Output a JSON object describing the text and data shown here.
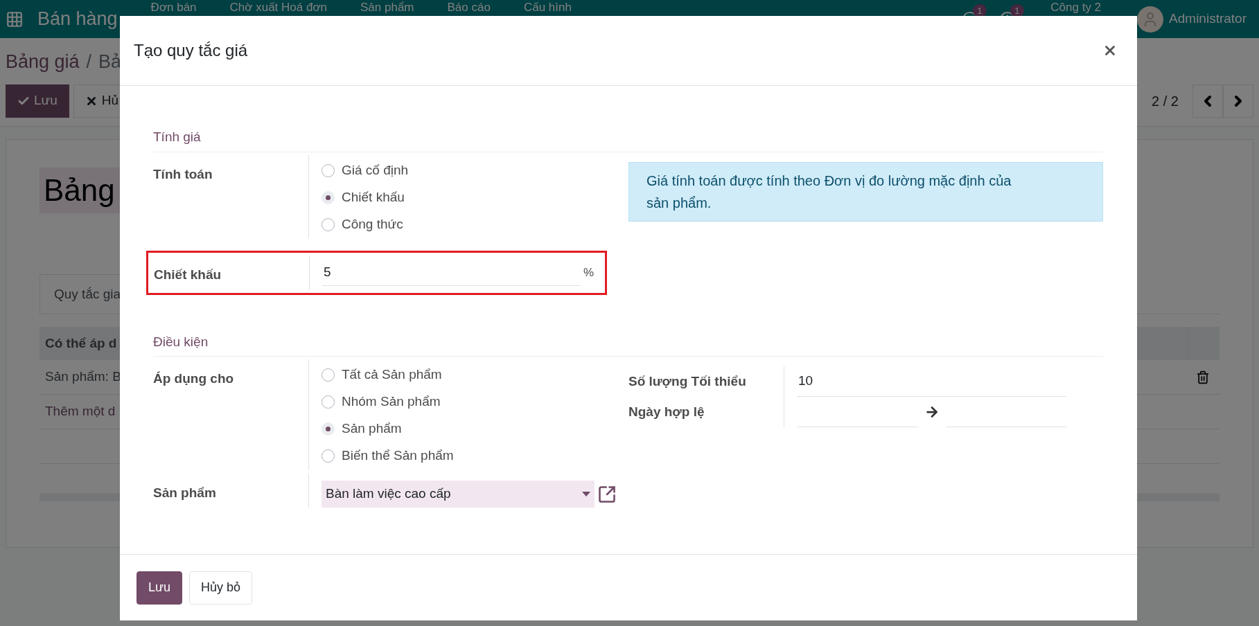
{
  "top_nav": {
    "app": "Bán hàng",
    "menu": [
      "Đơn bán",
      "Chờ xuất Hoá đơn",
      "Sản phẩm",
      "Báo cáo",
      "Cấu hình"
    ],
    "chat_badge": "1",
    "activity_badge": "1",
    "company": "Công ty 2",
    "user": "Administrator"
  },
  "breadcrumb": {
    "items": [
      "Bảng giá",
      "Bả"
    ],
    "separator": "/"
  },
  "control_buttons": [
    {
      "label": "Lưu",
      "kind": "primary"
    },
    {
      "label": "Hủ",
      "kind": "secondary"
    }
  ],
  "pager": "2 / 2",
  "form": {
    "title": "Bảng",
    "tabs": [
      {
        "label": "Quy tắc gia",
        "selected": true
      }
    ],
    "table": {
      "columns": [
        "Có thể áp d"
      ],
      "rows": [
        "Sản phẩm: B"
      ],
      "add_line": "Thêm một d"
    }
  },
  "dialog": {
    "title": "Tạo quy tắc giá",
    "sections": [
      {
        "title": "Tính giá",
        "fields": [
          {
            "kind": "radio",
            "label": "Tính toán",
            "options": [
              {
                "label": "Giá cố định",
                "selected": false
              },
              {
                "label": "Chiết khấu",
                "selected": true
              },
              {
                "label": "Công thức",
                "selected": false
              }
            ]
          },
          {
            "kind": "number",
            "label": "Chiết khấu",
            "value": "5",
            "suffix": "%",
            "highlighted": true
          }
        ],
        "note": "Giá tính toán được tính theo Đơn vị đo lường mặc định của sản phẩm."
      },
      {
        "title": "Điều kiện",
        "fields": [
          {
            "kind": "radio",
            "label": "Áp dụng cho",
            "options": [
              {
                "label": "Tất cả Sản phẩm",
                "selected": false
              },
              {
                "label": "Nhóm Sản phẩm",
                "selected": false
              },
              {
                "label": "Sản phẩm",
                "selected": true
              },
              {
                "label": "Biến thể Sản phẩm",
                "selected": false
              }
            ]
          },
          {
            "kind": "select",
            "label": "Sản phẩm",
            "value": "Bàn làm việc cao cấp"
          }
        ],
        "right_fields": [
          {
            "kind": "text",
            "label": "Số lượng Tối thiểu",
            "value": "10"
          },
          {
            "kind": "daterange",
            "label": "Ngày hợp lệ"
          }
        ]
      }
    ],
    "buttons": [
      {
        "label": "Lưu",
        "kind": "primary"
      },
      {
        "label": "Hủy bỏ",
        "kind": "secondary"
      }
    ]
  }
}
